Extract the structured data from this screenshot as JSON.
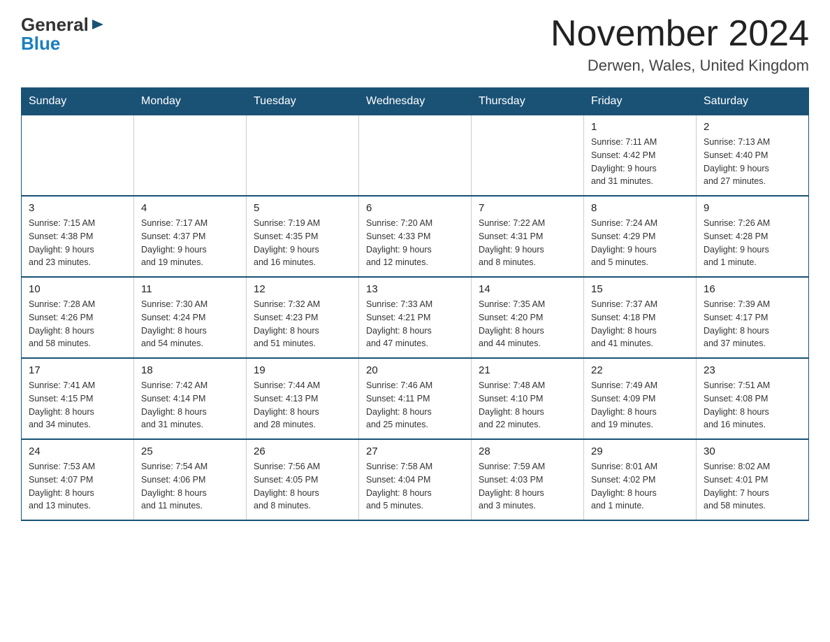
{
  "header": {
    "logo_general": "General",
    "logo_blue": "Blue",
    "month_title": "November 2024",
    "location": "Derwen, Wales, United Kingdom"
  },
  "weekdays": [
    "Sunday",
    "Monday",
    "Tuesday",
    "Wednesday",
    "Thursday",
    "Friday",
    "Saturday"
  ],
  "weeks": [
    [
      {
        "day": "",
        "info": ""
      },
      {
        "day": "",
        "info": ""
      },
      {
        "day": "",
        "info": ""
      },
      {
        "day": "",
        "info": ""
      },
      {
        "day": "",
        "info": ""
      },
      {
        "day": "1",
        "info": "Sunrise: 7:11 AM\nSunset: 4:42 PM\nDaylight: 9 hours\nand 31 minutes."
      },
      {
        "day": "2",
        "info": "Sunrise: 7:13 AM\nSunset: 4:40 PM\nDaylight: 9 hours\nand 27 minutes."
      }
    ],
    [
      {
        "day": "3",
        "info": "Sunrise: 7:15 AM\nSunset: 4:38 PM\nDaylight: 9 hours\nand 23 minutes."
      },
      {
        "day": "4",
        "info": "Sunrise: 7:17 AM\nSunset: 4:37 PM\nDaylight: 9 hours\nand 19 minutes."
      },
      {
        "day": "5",
        "info": "Sunrise: 7:19 AM\nSunset: 4:35 PM\nDaylight: 9 hours\nand 16 minutes."
      },
      {
        "day": "6",
        "info": "Sunrise: 7:20 AM\nSunset: 4:33 PM\nDaylight: 9 hours\nand 12 minutes."
      },
      {
        "day": "7",
        "info": "Sunrise: 7:22 AM\nSunset: 4:31 PM\nDaylight: 9 hours\nand 8 minutes."
      },
      {
        "day": "8",
        "info": "Sunrise: 7:24 AM\nSunset: 4:29 PM\nDaylight: 9 hours\nand 5 minutes."
      },
      {
        "day": "9",
        "info": "Sunrise: 7:26 AM\nSunset: 4:28 PM\nDaylight: 9 hours\nand 1 minute."
      }
    ],
    [
      {
        "day": "10",
        "info": "Sunrise: 7:28 AM\nSunset: 4:26 PM\nDaylight: 8 hours\nand 58 minutes."
      },
      {
        "day": "11",
        "info": "Sunrise: 7:30 AM\nSunset: 4:24 PM\nDaylight: 8 hours\nand 54 minutes."
      },
      {
        "day": "12",
        "info": "Sunrise: 7:32 AM\nSunset: 4:23 PM\nDaylight: 8 hours\nand 51 minutes."
      },
      {
        "day": "13",
        "info": "Sunrise: 7:33 AM\nSunset: 4:21 PM\nDaylight: 8 hours\nand 47 minutes."
      },
      {
        "day": "14",
        "info": "Sunrise: 7:35 AM\nSunset: 4:20 PM\nDaylight: 8 hours\nand 44 minutes."
      },
      {
        "day": "15",
        "info": "Sunrise: 7:37 AM\nSunset: 4:18 PM\nDaylight: 8 hours\nand 41 minutes."
      },
      {
        "day": "16",
        "info": "Sunrise: 7:39 AM\nSunset: 4:17 PM\nDaylight: 8 hours\nand 37 minutes."
      }
    ],
    [
      {
        "day": "17",
        "info": "Sunrise: 7:41 AM\nSunset: 4:15 PM\nDaylight: 8 hours\nand 34 minutes."
      },
      {
        "day": "18",
        "info": "Sunrise: 7:42 AM\nSunset: 4:14 PM\nDaylight: 8 hours\nand 31 minutes."
      },
      {
        "day": "19",
        "info": "Sunrise: 7:44 AM\nSunset: 4:13 PM\nDaylight: 8 hours\nand 28 minutes."
      },
      {
        "day": "20",
        "info": "Sunrise: 7:46 AM\nSunset: 4:11 PM\nDaylight: 8 hours\nand 25 minutes."
      },
      {
        "day": "21",
        "info": "Sunrise: 7:48 AM\nSunset: 4:10 PM\nDaylight: 8 hours\nand 22 minutes."
      },
      {
        "day": "22",
        "info": "Sunrise: 7:49 AM\nSunset: 4:09 PM\nDaylight: 8 hours\nand 19 minutes."
      },
      {
        "day": "23",
        "info": "Sunrise: 7:51 AM\nSunset: 4:08 PM\nDaylight: 8 hours\nand 16 minutes."
      }
    ],
    [
      {
        "day": "24",
        "info": "Sunrise: 7:53 AM\nSunset: 4:07 PM\nDaylight: 8 hours\nand 13 minutes."
      },
      {
        "day": "25",
        "info": "Sunrise: 7:54 AM\nSunset: 4:06 PM\nDaylight: 8 hours\nand 11 minutes."
      },
      {
        "day": "26",
        "info": "Sunrise: 7:56 AM\nSunset: 4:05 PM\nDaylight: 8 hours\nand 8 minutes."
      },
      {
        "day": "27",
        "info": "Sunrise: 7:58 AM\nSunset: 4:04 PM\nDaylight: 8 hours\nand 5 minutes."
      },
      {
        "day": "28",
        "info": "Sunrise: 7:59 AM\nSunset: 4:03 PM\nDaylight: 8 hours\nand 3 minutes."
      },
      {
        "day": "29",
        "info": "Sunrise: 8:01 AM\nSunset: 4:02 PM\nDaylight: 8 hours\nand 1 minute."
      },
      {
        "day": "30",
        "info": "Sunrise: 8:02 AM\nSunset: 4:01 PM\nDaylight: 7 hours\nand 58 minutes."
      }
    ]
  ]
}
